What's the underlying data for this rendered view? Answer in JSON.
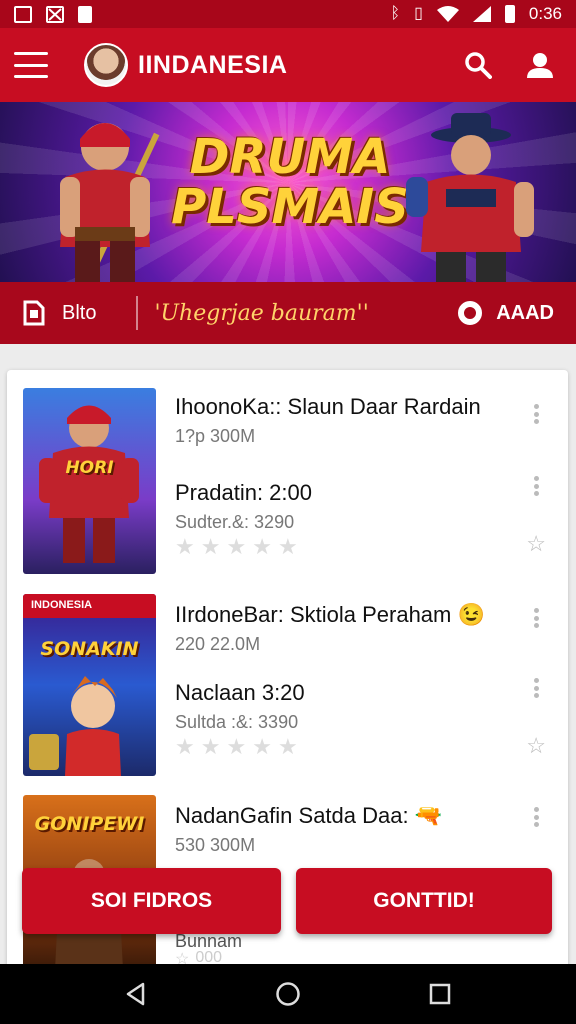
{
  "status_bar": {
    "time": "0:36",
    "left_icons": [
      "image-icon",
      "no-image-icon",
      "sim-icon"
    ],
    "right_icons": [
      "bluetooth-icon",
      "vibrate-icon",
      "wifi-icon",
      "signal-icon",
      "battery-icon"
    ]
  },
  "app_bar": {
    "title": "IINDANESIA",
    "icons": [
      "menu-icon",
      "avatar",
      "search-icon",
      "account-icon"
    ]
  },
  "banner": {
    "title_line1": "DRUMA",
    "title_line2": "PLSMAIS"
  },
  "strip": {
    "left_label": "Blto",
    "tagline": "'Uhegrjae bauram''",
    "right_label": "AAAD"
  },
  "list": [
    {
      "title": "IhoonoKa:: Slaun Daar Rardain",
      "size": "1?p 300M",
      "subtitle": "Pradatin: 2:00",
      "detail": "Sudter.&: 3290",
      "rating": 0,
      "thumb_label": "HORI"
    },
    {
      "title": "IIrdoneBar: Sktiola Peraham 😉",
      "size": "220 22.0M",
      "subtitle": "Naclaan 3:20",
      "detail": "Sultda :&: 3390",
      "rating": 0,
      "thumb_header": "INDONESIA",
      "thumb_label": "SONAKIN"
    },
    {
      "title": "NadanGafin Satda Daa: 🔫",
      "size": "530 300M",
      "detail": "Bunnam",
      "rating_text": "000",
      "thumb_label": "GONIPEWI"
    }
  ],
  "buttons": {
    "left": "SOI FIDROS",
    "right": "GONTTID!"
  },
  "colors": {
    "primary": "#c70d22",
    "dark_primary": "#a8061a",
    "banner_gold": "#ffd23a"
  }
}
